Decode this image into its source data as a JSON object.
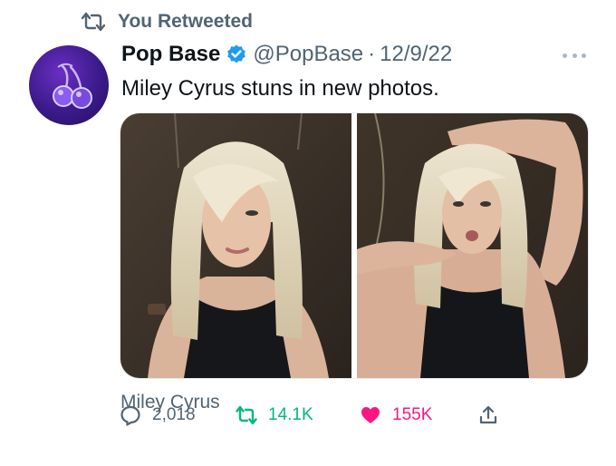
{
  "social_context": {
    "text": "You Retweeted"
  },
  "author": {
    "name": "Pop Base",
    "handle": "@PopBase",
    "separator": "·",
    "date": "12/9/22"
  },
  "tweet": {
    "text": "Miley Cyrus stuns in new photos."
  },
  "media": {
    "caption": "Miley Cyrus",
    "count": 2
  },
  "actions": {
    "replies": "2,018",
    "retweets": "14.1K",
    "likes": "155K"
  },
  "colors": {
    "retweet_green": "#00ba7c",
    "like_pink": "#f91880",
    "verified_blue": "#1d9bf0",
    "muted_gray": "#536471"
  },
  "icons": [
    "retweet-icon",
    "avatar",
    "verified-badge-icon",
    "more-icon",
    "reply-icon",
    "like-icon",
    "share-icon"
  ]
}
